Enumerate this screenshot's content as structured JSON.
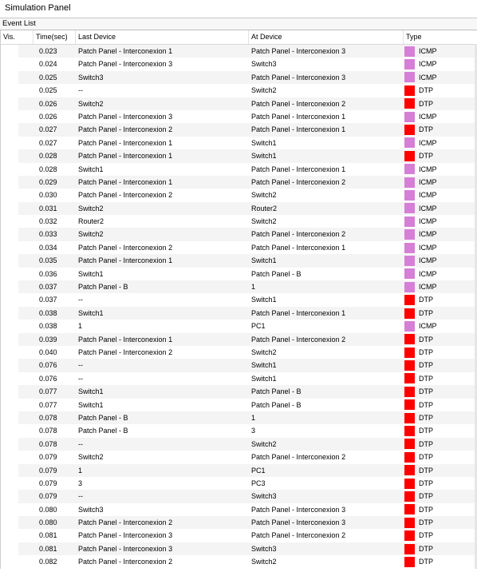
{
  "panel": {
    "title": "Simulation Panel",
    "section": "Event List"
  },
  "columns": {
    "vis": "Vis.",
    "time": "Time(sec)",
    "last": "Last Device",
    "at": "At Device",
    "type": "Type"
  },
  "colors": {
    "ICMP": "#d67fd6",
    "DTP": "#ff0000"
  },
  "events": [
    {
      "time": "0.023",
      "last": "Patch Panel - Interconexion 1",
      "at": "Patch Panel - Interconexion 3",
      "type": "ICMP"
    },
    {
      "time": "0.024",
      "last": "Patch Panel - Interconexion 3",
      "at": "Switch3",
      "type": "ICMP"
    },
    {
      "time": "0.025",
      "last": "Switch3",
      "at": "Patch Panel - Interconexion 3",
      "type": "ICMP"
    },
    {
      "time": "0.025",
      "last": "--",
      "at": "Switch2",
      "type": "DTP"
    },
    {
      "time": "0.026",
      "last": "Switch2",
      "at": "Patch Panel - Interconexion 2",
      "type": "DTP"
    },
    {
      "time": "0.026",
      "last": "Patch Panel - Interconexion 3",
      "at": "Patch Panel - Interconexion 1",
      "type": "ICMP"
    },
    {
      "time": "0.027",
      "last": "Patch Panel - Interconexion 2",
      "at": "Patch Panel - Interconexion 1",
      "type": "DTP"
    },
    {
      "time": "0.027",
      "last": "Patch Panel - Interconexion 1",
      "at": "Switch1",
      "type": "ICMP"
    },
    {
      "time": "0.028",
      "last": "Patch Panel - Interconexion 1",
      "at": "Switch1",
      "type": "DTP"
    },
    {
      "time": "0.028",
      "last": "Switch1",
      "at": "Patch Panel - Interconexion 1",
      "type": "ICMP"
    },
    {
      "time": "0.029",
      "last": "Patch Panel - Interconexion 1",
      "at": "Patch Panel - Interconexion 2",
      "type": "ICMP"
    },
    {
      "time": "0.030",
      "last": "Patch Panel - Interconexion 2",
      "at": "Switch2",
      "type": "ICMP"
    },
    {
      "time": "0.031",
      "last": "Switch2",
      "at": "Router2",
      "type": "ICMP"
    },
    {
      "time": "0.032",
      "last": "Router2",
      "at": "Switch2",
      "type": "ICMP"
    },
    {
      "time": "0.033",
      "last": "Switch2",
      "at": "Patch Panel - Interconexion 2",
      "type": "ICMP"
    },
    {
      "time": "0.034",
      "last": "Patch Panel - Interconexion 2",
      "at": "Patch Panel - Interconexion 1",
      "type": "ICMP"
    },
    {
      "time": "0.035",
      "last": "Patch Panel - Interconexion 1",
      "at": "Switch1",
      "type": "ICMP"
    },
    {
      "time": "0.036",
      "last": "Switch1",
      "at": "Patch Panel - B",
      "type": "ICMP"
    },
    {
      "time": "0.037",
      "last": "Patch Panel - B",
      "at": "1",
      "type": "ICMP"
    },
    {
      "time": "0.037",
      "last": "--",
      "at": "Switch1",
      "type": "DTP"
    },
    {
      "time": "0.038",
      "last": "Switch1",
      "at": "Patch Panel - Interconexion 1",
      "type": "DTP"
    },
    {
      "time": "0.038",
      "last": "1",
      "at": "PC1",
      "type": "ICMP"
    },
    {
      "time": "0.039",
      "last": "Patch Panel - Interconexion 1",
      "at": "Patch Panel - Interconexion 2",
      "type": "DTP"
    },
    {
      "time": "0.040",
      "last": "Patch Panel - Interconexion 2",
      "at": "Switch2",
      "type": "DTP"
    },
    {
      "time": "0.076",
      "last": "--",
      "at": "Switch1",
      "type": "DTP"
    },
    {
      "time": "0.076",
      "last": "--",
      "at": "Switch1",
      "type": "DTP"
    },
    {
      "time": "0.077",
      "last": "Switch1",
      "at": "Patch Panel - B",
      "type": "DTP"
    },
    {
      "time": "0.077",
      "last": "Switch1",
      "at": "Patch Panel - B",
      "type": "DTP"
    },
    {
      "time": "0.078",
      "last": "Patch Panel - B",
      "at": "1",
      "type": "DTP"
    },
    {
      "time": "0.078",
      "last": "Patch Panel - B",
      "at": "3",
      "type": "DTP"
    },
    {
      "time": "0.078",
      "last": "--",
      "at": "Switch2",
      "type": "DTP"
    },
    {
      "time": "0.079",
      "last": "Switch2",
      "at": "Patch Panel - Interconexion 2",
      "type": "DTP"
    },
    {
      "time": "0.079",
      "last": "1",
      "at": "PC1",
      "type": "DTP"
    },
    {
      "time": "0.079",
      "last": "3",
      "at": "PC3",
      "type": "DTP"
    },
    {
      "time": "0.079",
      "last": "--",
      "at": "Switch3",
      "type": "DTP"
    },
    {
      "time": "0.080",
      "last": "Switch3",
      "at": "Patch Panel - Interconexion 3",
      "type": "DTP"
    },
    {
      "time": "0.080",
      "last": "Patch Panel - Interconexion 2",
      "at": "Patch Panel - Interconexion 3",
      "type": "DTP"
    },
    {
      "time": "0.081",
      "last": "Patch Panel - Interconexion 3",
      "at": "Patch Panel - Interconexion 2",
      "type": "DTP"
    },
    {
      "time": "0.081",
      "last": "Patch Panel - Interconexion 3",
      "at": "Switch3",
      "type": "DTP"
    },
    {
      "time": "0.082",
      "last": "Patch Panel - Interconexion 2",
      "at": "Switch2",
      "type": "DTP"
    }
  ]
}
